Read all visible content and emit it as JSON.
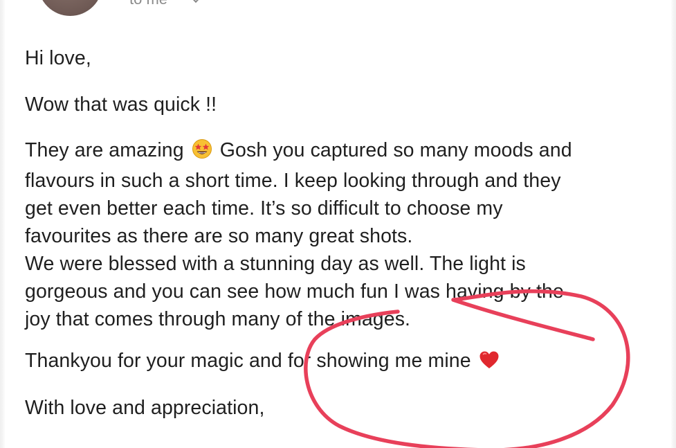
{
  "header": {
    "recipient": "to me",
    "avatar_icon": "avatar-icon",
    "chevron_icon": "chevron-down-icon"
  },
  "body": {
    "greeting": "Hi love,",
    "line2": "Wow that was quick !!",
    "para_lines": [
      "They are amazing",
      "Gosh you captured so many moods and",
      "flavours in such a short time. I keep looking through and they",
      "get even better each time. It’s so difficult to choose my",
      "favourites as there are so many great shots.",
      "We were blessed with a stunning day as well. The light is",
      "gorgeous and you can see how much fun I was having by the",
      "joy that comes through many of the images."
    ],
    "thanks": "Thankyou for your magic and for showing me mine",
    "signoff": "With love and appreciation,"
  },
  "emoji": {
    "star_struck": "star-struck-emoji",
    "heart": "red-heart-emoji"
  },
  "colors": {
    "text": "#1f1f1f",
    "muted": "#8a8a8a",
    "annotation": "#e8405a",
    "heart": "#e0282e"
  }
}
